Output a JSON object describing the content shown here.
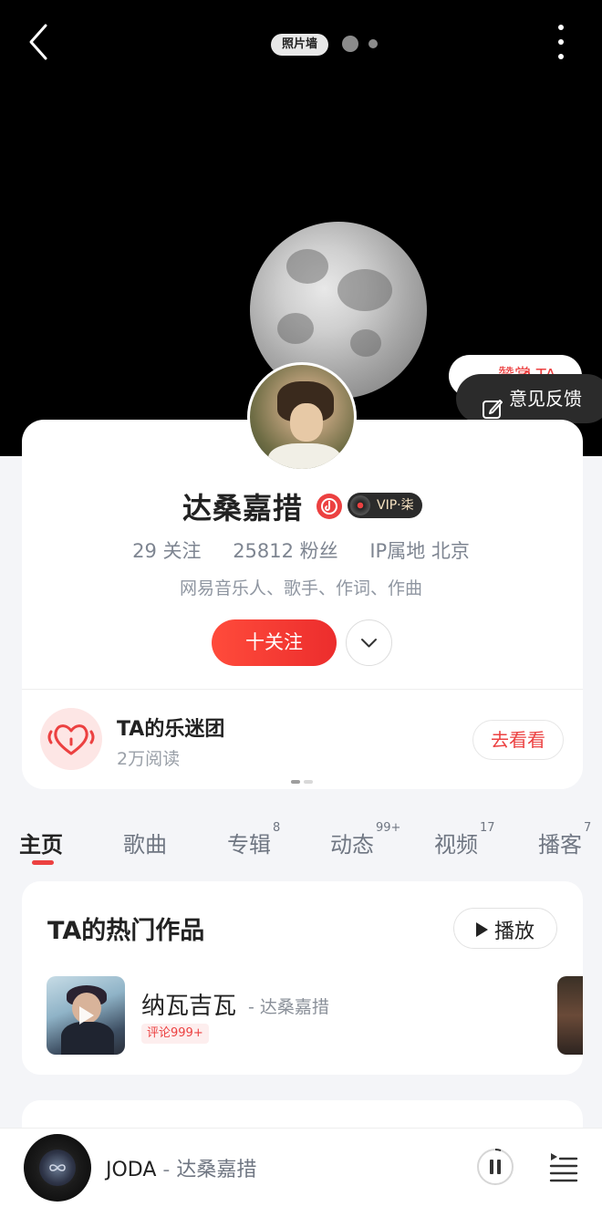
{
  "header": {
    "photo_wall_label": "照片墙"
  },
  "hero": {
    "reward_label": "赞赏 TA",
    "feedback_label": "意见反馈"
  },
  "profile": {
    "name": "达桑嘉措",
    "vip_label": "VIP·柒",
    "following": "29 关注",
    "followers": "25812 粉丝",
    "ip_location": "IP属地 北京",
    "tags": "网易音乐人、歌手、作词、作曲",
    "follow_button": "十关注"
  },
  "fan_club": {
    "title": "TA的乐迷团",
    "reads": "2万阅读",
    "action": "去看看"
  },
  "tabs": [
    {
      "label": "主页",
      "count": ""
    },
    {
      "label": "歌曲",
      "count": ""
    },
    {
      "label": "专辑",
      "count": "8"
    },
    {
      "label": "动态",
      "count": "99+"
    },
    {
      "label": "视频",
      "count": "17"
    },
    {
      "label": "播客",
      "count": "7"
    }
  ],
  "hot_works": {
    "title": "TA的热门作品",
    "play_label": "播放",
    "songs": [
      {
        "title": "纳瓦吉瓦",
        "artist": "- 达桑嘉措",
        "comment_badge": "评论999+"
      }
    ]
  },
  "player": {
    "song": "JODA",
    "separator": " - ",
    "artist": "达桑嘉措"
  },
  "colors": {
    "accent": "#ec4141",
    "hero_bg": "#000000",
    "page_bg": "#f4f5f8"
  }
}
